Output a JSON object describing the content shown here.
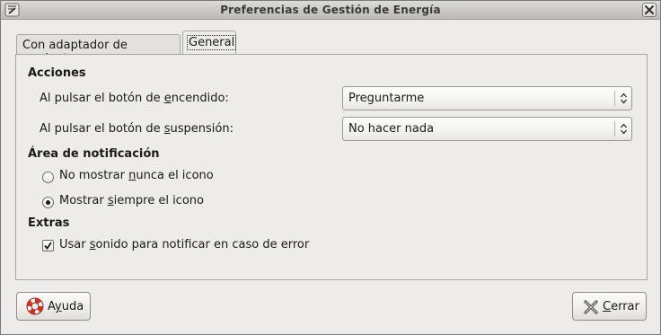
{
  "window": {
    "title": "Preferencias de Gestión de Energía"
  },
  "tabs": [
    {
      "label": "Con adaptador de corriente",
      "active": false
    },
    {
      "label": "General",
      "active": true
    }
  ],
  "acciones": {
    "heading": "Acciones",
    "power_button": {
      "label_pre": "Al pulsar el botón de ",
      "label_mnemonic": "e",
      "label_post": "ncendido:",
      "value": "Preguntarme"
    },
    "suspend_button": {
      "label_pre": "Al pulsar el botón de ",
      "label_mnemonic": "s",
      "label_post": "uspensión:",
      "value": "No hacer nada"
    }
  },
  "notificacion": {
    "heading": "Área de notificación",
    "options": [
      {
        "pre": "No mostrar ",
        "mnemonic": "n",
        "post": "unca el icono",
        "selected": false
      },
      {
        "pre": "Mostrar ",
        "mnemonic": "s",
        "post": "iempre el icono",
        "selected": true
      }
    ]
  },
  "extras": {
    "heading": "Extras",
    "sound": {
      "pre": "Usar ",
      "mnemonic": "s",
      "post": "onido para notificar en caso de error",
      "checked": true
    }
  },
  "buttons": {
    "help": {
      "pre": "A",
      "mnemonic": "y",
      "post": "uda",
      "icon": "lifebuoy-icon"
    },
    "close": {
      "pre": "",
      "mnemonic": "C",
      "post": "errar",
      "icon": "close-x-icon"
    }
  }
}
